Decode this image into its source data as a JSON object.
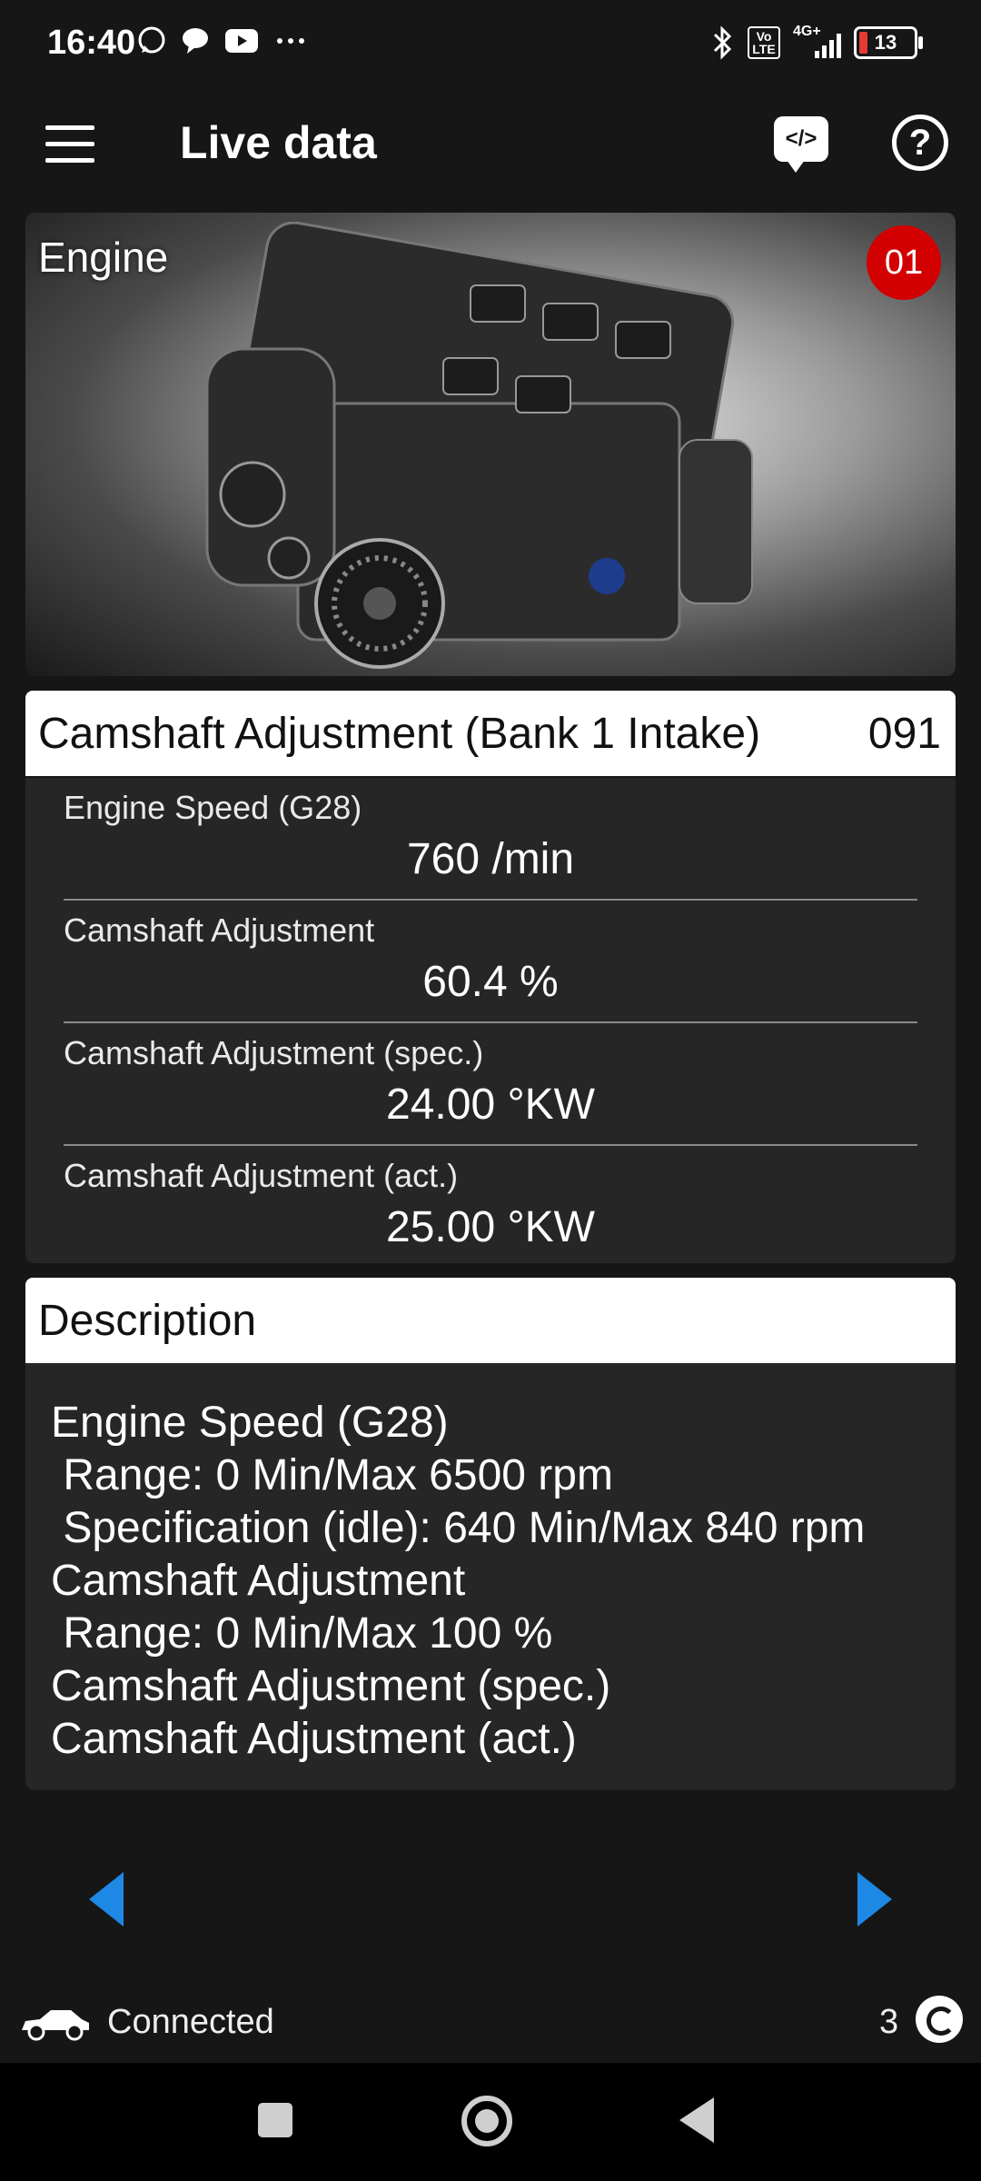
{
  "status_bar": {
    "time": "16:40",
    "notification_icons": [
      "whatsapp-icon",
      "chat-bubble-icon",
      "youtube-icon",
      "more-dots-icon"
    ],
    "system_icons": [
      "bluetooth-icon",
      "volte-icon",
      "4g-signal-icon"
    ],
    "network": "4G+",
    "volte": "Vo LTE",
    "battery_level": "13"
  },
  "app_bar": {
    "title": "Live data",
    "code_icon_text": "</>",
    "help_icon_text": "?"
  },
  "engine_card": {
    "title": "Engine",
    "badge": "01"
  },
  "group": {
    "title": "Camshaft Adjustment (Bank 1 Intake)",
    "number": "091",
    "values": [
      {
        "label": "Engine Speed (G28)",
        "value": "760 /min"
      },
      {
        "label": "Camshaft Adjustment",
        "value": "60.4 %"
      },
      {
        "label": "Camshaft Adjustment (spec.)",
        "value": "24.00 °KW"
      },
      {
        "label": "Camshaft Adjustment (act.)",
        "value": "25.00 °KW"
      }
    ]
  },
  "description": {
    "title": "Description",
    "lines": [
      "Engine Speed (G28)",
      " Range: 0 Min/Max 6500 rpm",
      " Specification (idle): 640 Min/Max 840 rpm",
      "Camshaft Adjustment",
      " Range: 0 Min/Max 100 %",
      "Camshaft Adjustment (spec.)",
      "Camshaft Adjustment (act.)"
    ]
  },
  "navigation": {
    "prev_icon": "triangle-left-icon",
    "next_icon": "triangle-right-icon",
    "accent_color": "#1e88e5"
  },
  "footer": {
    "status": "Connected",
    "count": "3"
  },
  "colors": {
    "background": "#161616",
    "panel": "#262626",
    "badge": "#d20000"
  }
}
